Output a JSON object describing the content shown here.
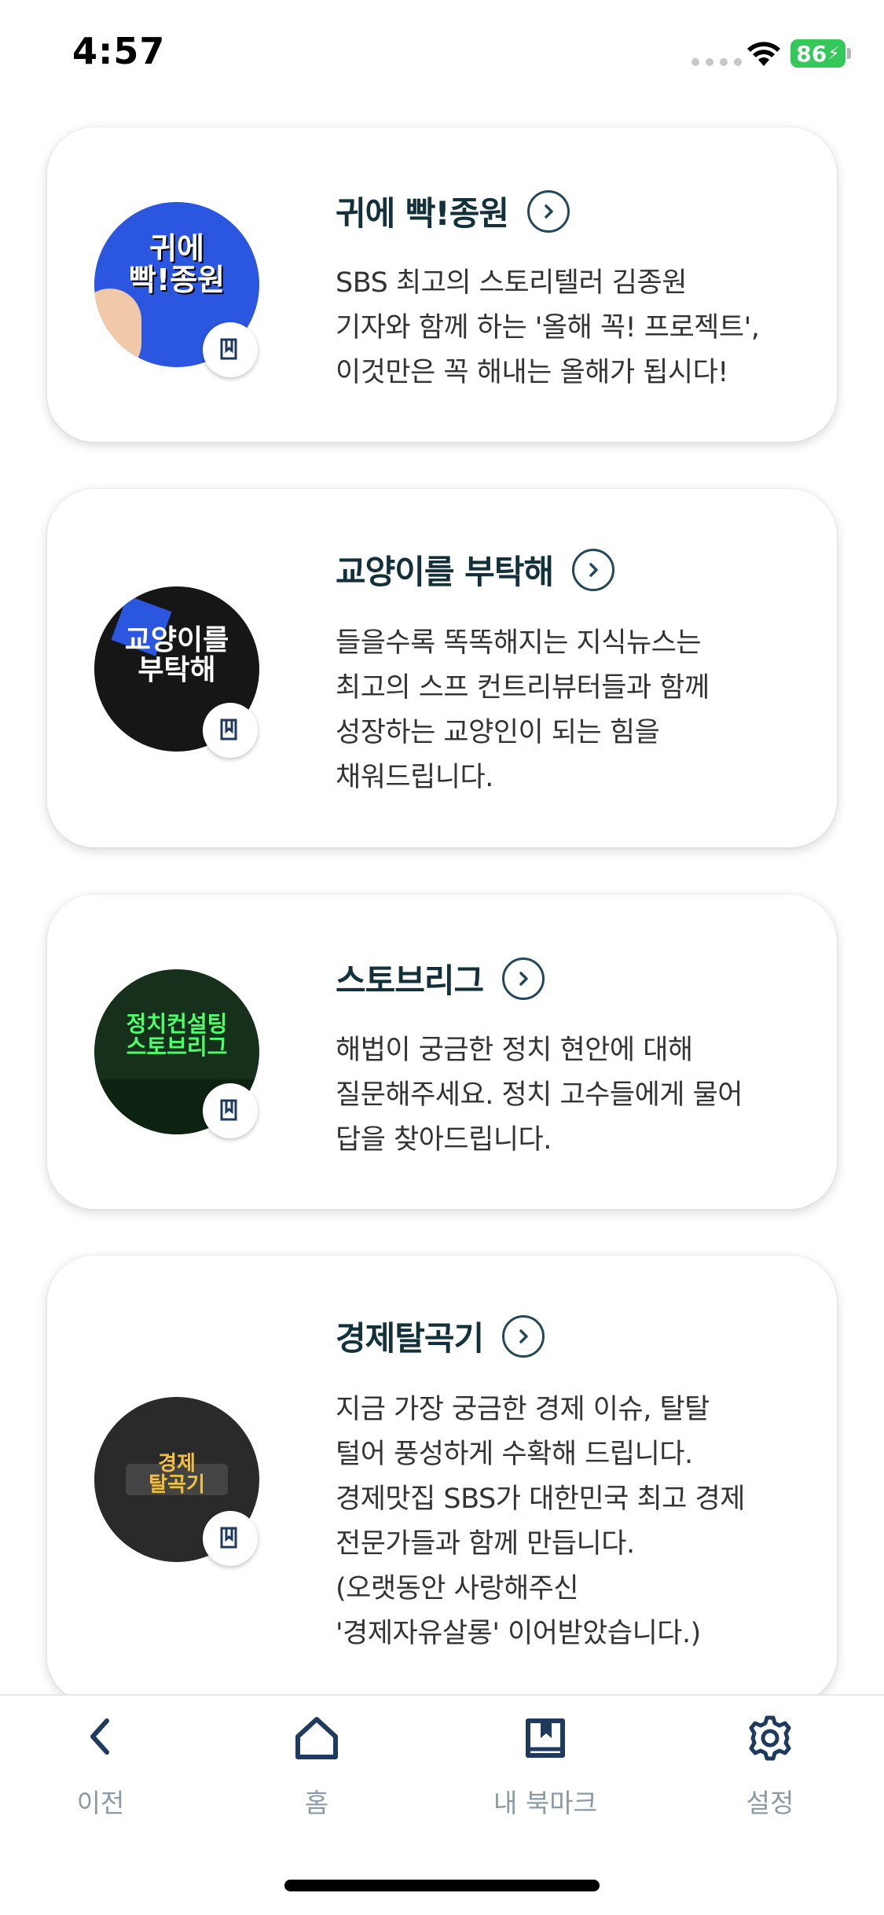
{
  "status_bar": {
    "time": "4:57",
    "battery": "86"
  },
  "cards": [
    {
      "title": "귀에 빡!종원",
      "description": "SBS 최고의 스토리텔러 김종원\n기자와 함께 하는 '올해 꼭! 프로젝트',\n이것만은 꼭 해내는 올해가 됩시다!",
      "thumb_text": "귀에\n빡!종원",
      "thumb_color": "#2a56e0"
    },
    {
      "title": "교양이를 부탁해",
      "description": "들을수록 똑똑해지는 지식뉴스는\n최고의 스프 컨트리뷰터들과 함께\n성장하는 교양인이 되는 힘을\n채워드립니다.",
      "thumb_text": "교양이를\n부탁해",
      "thumb_color": "#161616"
    },
    {
      "title": "스토브리그",
      "description": "해법이 궁금한 정치 현안에 대해\n질문해주세요. 정치 고수들에게 물어\n답을 찾아드립니다.",
      "thumb_text": "정치컨설팅\n스토브리그",
      "thumb_color": "#16301c"
    },
    {
      "title": "경제탈곡기",
      "description": "지금 가장 궁금한 경제 이슈, 탈탈\n털어 풍성하게 수확해 드립니다.\n경제맛집 SBS가 대한민국 최고 경제\n전문가들과 함께 만듭니다.\n(오랫동안 사랑해주신\n'경제자유살롱' 이어받았습니다.)",
      "thumb_text": "경제\n탈곡기",
      "thumb_color": "#2a2a2a"
    }
  ],
  "tab_bar": {
    "items": [
      {
        "label": "이전",
        "icon": "chevron-left-icon"
      },
      {
        "label": "홈",
        "icon": "home-icon"
      },
      {
        "label": "내 북마크",
        "icon": "book-bookmark-icon"
      },
      {
        "label": "설정",
        "icon": "gear-icon"
      }
    ],
    "icon_color": "#1f3a5f",
    "label_color": "#8a9aa6"
  }
}
